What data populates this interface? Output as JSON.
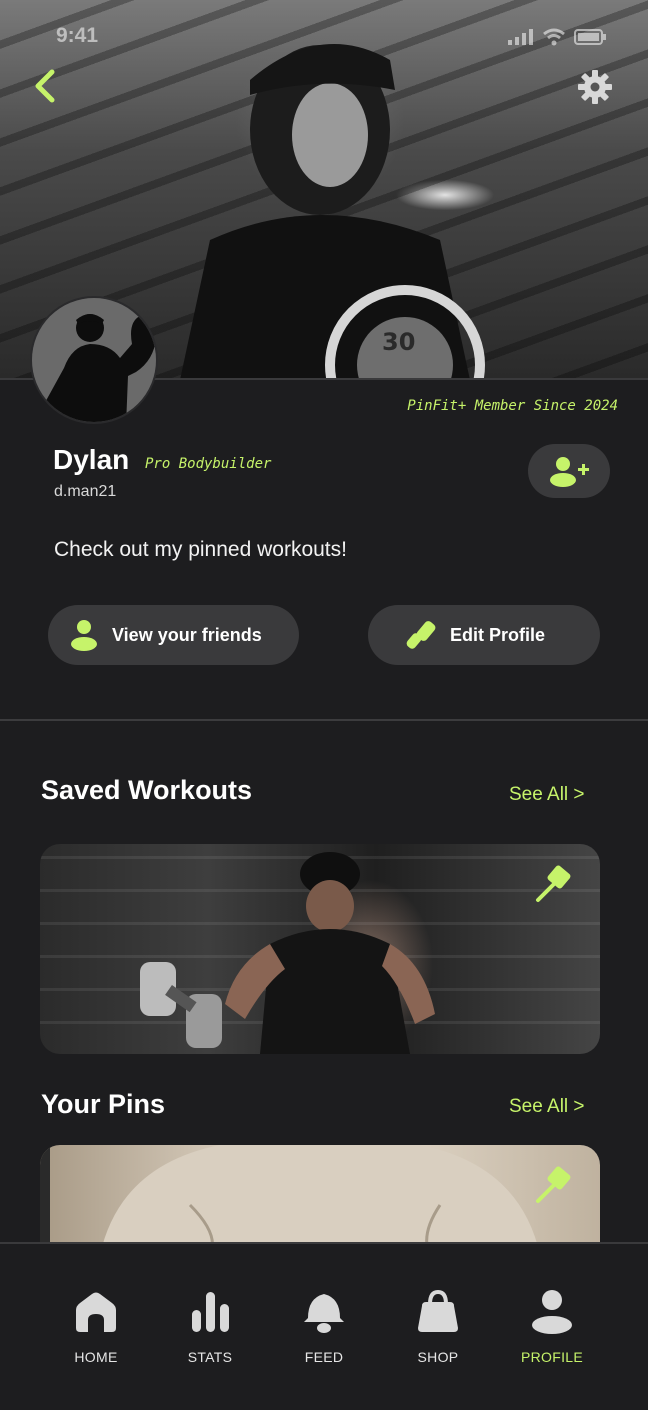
{
  "status_bar": {
    "time": "9:41"
  },
  "profile": {
    "member_since": "PinFit+ Member Since 2024",
    "name": "Dylan",
    "tagline": "Pro Bodybuilder",
    "username": "d.man21",
    "bio": "Check out my pinned workouts!"
  },
  "actions": {
    "view_friends": "View your friends",
    "edit_profile": "Edit Profile"
  },
  "sections": {
    "saved_workouts": {
      "title": "Saved Workouts",
      "see_all": "See All >"
    },
    "your_pins": {
      "title": "Your Pins",
      "see_all": "See All >"
    }
  },
  "tabbar": {
    "items": [
      {
        "label": "HOME",
        "icon": "home-icon"
      },
      {
        "label": "STATS",
        "icon": "stats-icon"
      },
      {
        "label": "FEED",
        "icon": "bell-icon"
      },
      {
        "label": "SHOP",
        "icon": "bag-icon"
      },
      {
        "label": "PROFILE",
        "icon": "person-icon"
      }
    ],
    "active": "PROFILE"
  },
  "colors": {
    "accent": "#c6f36a",
    "background": "#1d1d1f",
    "surface": "#3a3a3c"
  }
}
